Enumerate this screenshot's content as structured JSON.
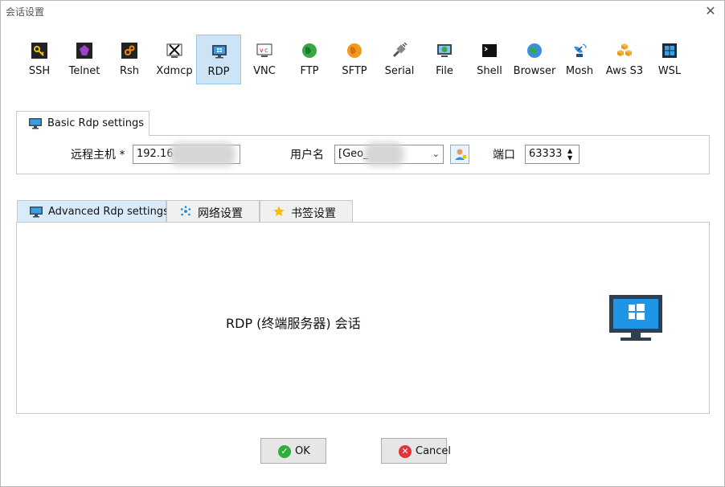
{
  "window": {
    "title": "会话设置",
    "close_glyph": "✕"
  },
  "protocols": [
    {
      "label": "SSH",
      "icon": "key-icon"
    },
    {
      "label": "Telnet",
      "icon": "telnet-icon"
    },
    {
      "label": "Rsh",
      "icon": "rsh-icon"
    },
    {
      "label": "Xdmcp",
      "icon": "xdmcp-icon"
    },
    {
      "label": "RDP",
      "icon": "rdp-monitor-icon",
      "selected": true
    },
    {
      "label": "VNC",
      "icon": "vnc-icon"
    },
    {
      "label": "FTP",
      "icon": "ftp-globe-icon"
    },
    {
      "label": "SFTP",
      "icon": "sftp-globe-icon"
    },
    {
      "label": "Serial",
      "icon": "serial-plug-icon"
    },
    {
      "label": "File",
      "icon": "file-monitor-icon"
    },
    {
      "label": "Shell",
      "icon": "shell-terminal-icon"
    },
    {
      "label": "Browser",
      "icon": "browser-globe-icon"
    },
    {
      "label": "Mosh",
      "icon": "mosh-satellite-icon"
    },
    {
      "label": "Aws S3",
      "icon": "aws-cubes-icon"
    },
    {
      "label": "WSL",
      "icon": "wsl-windows-icon"
    }
  ],
  "basic": {
    "tab_label": "Basic Rdp settings",
    "host_label": "远程主机 *",
    "host_value": "192.16",
    "user_label": "用户名",
    "user_value": "[Geo_",
    "port_label": "端口",
    "port_value": "63333",
    "spin_up": "▲",
    "spin_down": "▼",
    "dropdown_glyph": "⌄"
  },
  "advanced_tabs": [
    {
      "label": "Advanced Rdp settings",
      "icon": "monitor-icon"
    },
    {
      "label": "网络设置",
      "icon": "network-icon"
    },
    {
      "label": "书签设置",
      "icon": "star-icon"
    }
  ],
  "advanced": {
    "session_text": "RDP (终端服务器) 会话"
  },
  "buttons": {
    "ok_label": "OK",
    "ok_glyph": "✓",
    "cancel_label": "Cancel",
    "cancel_glyph": "✕"
  },
  "colors": {
    "accent": "#0a74c9",
    "selected_bg": "#cde4f7",
    "ok_green": "#2fae3c",
    "cancel_red": "#e0343a"
  }
}
